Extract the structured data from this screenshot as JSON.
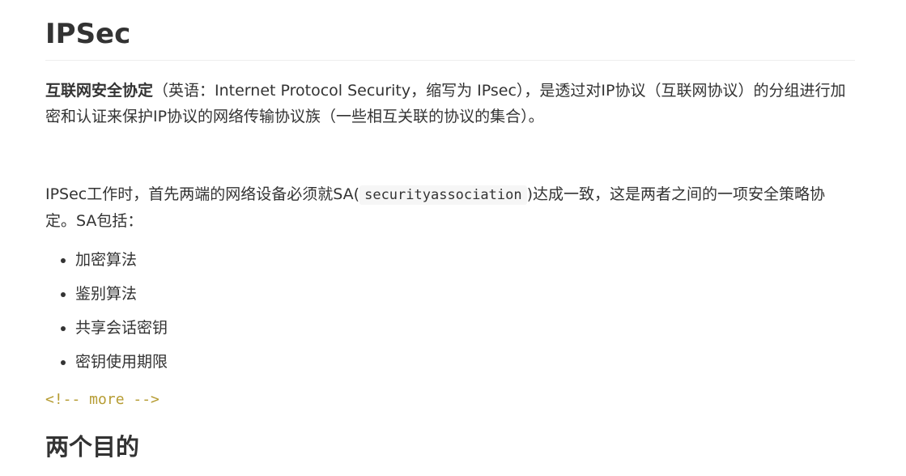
{
  "title": "IPSec",
  "intro": {
    "term": "互联网安全协定",
    "text": "（英语：Internet Protocol Security，缩写为 IPsec），是透过对IP协议（互联网协议）的分组进行加密和认证来保护IP协议的网络传输协议族（一些相互关联的协议的集合）。"
  },
  "sa_paragraph": {
    "before": "IPSec工作时，首先两端的网络设备必须就SA(",
    "code": "securityassociation",
    "after": ")达成一致，这是两者之间的一项安全策略协定。SA包括："
  },
  "sa_items": [
    "加密算法",
    "鉴别算法",
    "共享会话密钥",
    "密钥使用期限"
  ],
  "comment": "<!-- more -->",
  "section_title": "两个目的"
}
